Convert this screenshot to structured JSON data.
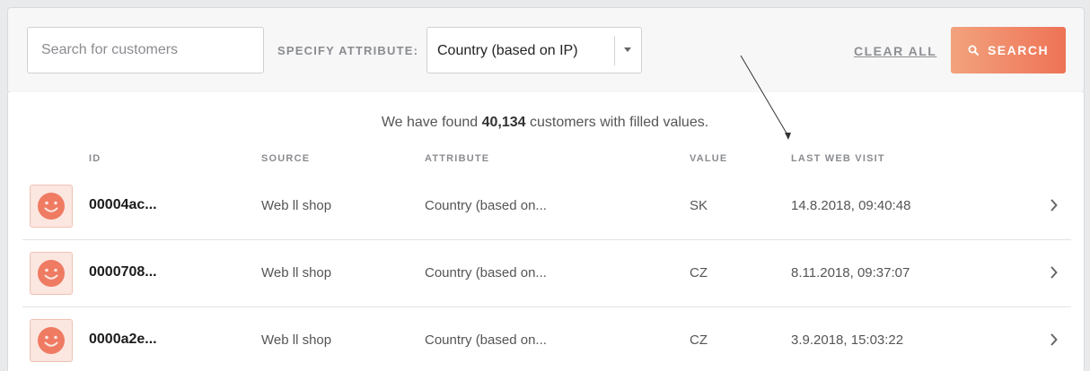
{
  "filter": {
    "search_placeholder": "Search for customers",
    "attribute_label": "SPECIFY ATTRIBUTE:",
    "attribute_selected": "Country (based on IP)",
    "clear_all": "CLEAR ALL",
    "search_button": "SEARCH"
  },
  "summary": {
    "prefix": "We have found ",
    "count": "40,134",
    "suffix": " customers with filled values."
  },
  "columns": {
    "id": "ID",
    "source": "SOURCE",
    "attribute": "ATTRIBUTE",
    "value": "VALUE",
    "last_visit": "LAST WEB VISIT"
  },
  "rows": [
    {
      "id": "00004ac...",
      "source": "Web ll shop",
      "attribute": "Country (based on...",
      "value": "SK",
      "last_visit": "14.8.2018, 09:40:48"
    },
    {
      "id": "0000708...",
      "source": "Web ll shop",
      "attribute": "Country (based on...",
      "value": "CZ",
      "last_visit": "8.11.2018, 09:37:07"
    },
    {
      "id": "0000a2e...",
      "source": "Web ll shop",
      "attribute": "Country (based on...",
      "value": "CZ",
      "last_visit": "3.9.2018, 15:03:22"
    }
  ],
  "colors": {
    "accent_start": "#f2a27d",
    "accent_end": "#ee7356",
    "avatar_face": "#ef7b62"
  },
  "icons": {
    "search_button": "search-icon",
    "avatar": "smiley-face-icon",
    "row_action": "chevron-right-icon",
    "select": "caret-down-icon"
  }
}
